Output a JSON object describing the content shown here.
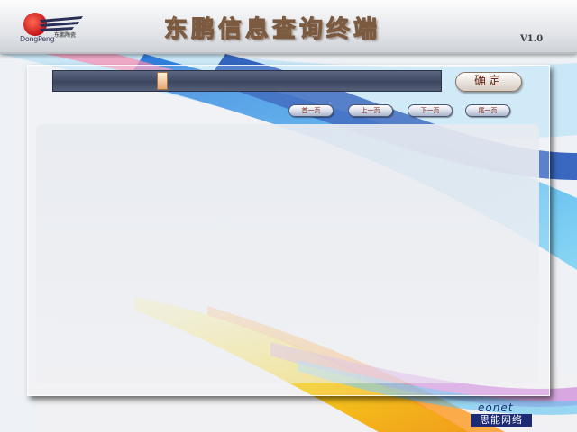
{
  "app": {
    "title": "东鹏信息查询终端",
    "version": "V1.0"
  },
  "logo": {
    "brand_en": "DongPeng",
    "brand_cn": "东鹏陶瓷"
  },
  "search": {
    "value": "",
    "confirm_label": "确定",
    "cursor_glyph": "鼠标"
  },
  "pager": {
    "first": "首一页",
    "prev": "上一页",
    "next": "下一页",
    "last": "尾一页"
  },
  "footer": {
    "brand_en": "eonet",
    "brand_cn": "思能网络"
  },
  "colors": {
    "title_text": "#f4c39a",
    "input_bg": "#3e4760",
    "accent_blue": "#1d2b74",
    "logo_red": "#c4121a"
  }
}
